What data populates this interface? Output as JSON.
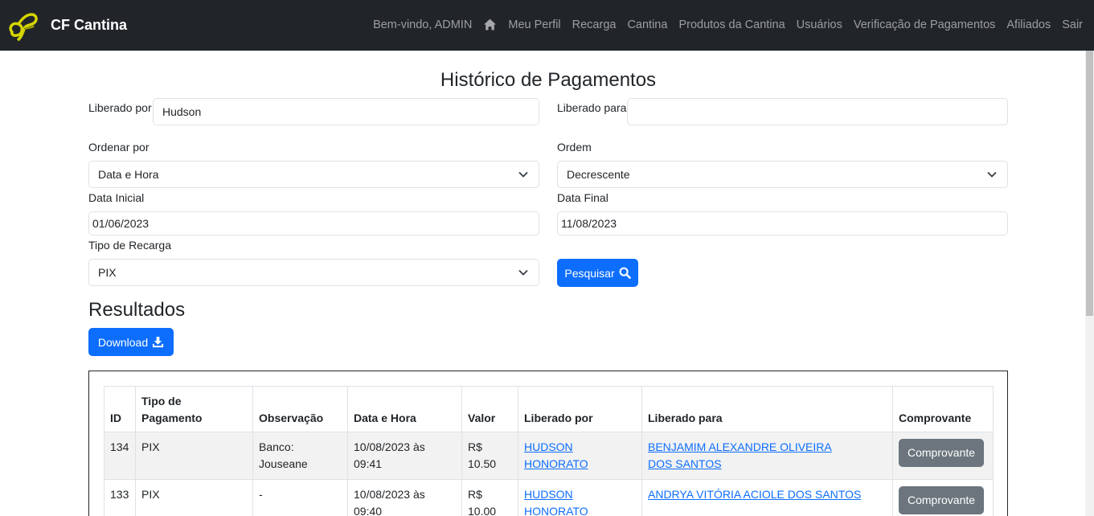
{
  "nav": {
    "brand": "CF Cantina",
    "welcome": "Bem-vindo, ADMIN",
    "links": [
      "Meu Perfil",
      "Recarga",
      "Cantina",
      "Produtos da Cantina",
      "Usuários",
      "Verificação de Pagamentos",
      "Afiliados",
      "Sair"
    ]
  },
  "page": {
    "title": "Histórico de Pagamentos"
  },
  "filters": {
    "liberado_por_label": "Liberado por",
    "liberado_por_value": "Hudson",
    "liberado_para_label": "Liberado para",
    "liberado_para_value": "",
    "ordenar_por_label": "Ordenar por",
    "ordenar_por_value": "Data e Hora",
    "ordem_label": "Ordem",
    "ordem_value": "Decrescente",
    "data_inicial_label": "Data Inicial",
    "data_inicial_value": "01/06/2023",
    "data_final_label": "Data Final",
    "data_final_value": "11/08/2023",
    "tipo_recarga_label": "Tipo de Recarga",
    "tipo_recarga_value": "PIX",
    "search_button": "Pesquisar"
  },
  "results": {
    "title": "Resultados",
    "download_button": "Download",
    "columns": [
      "ID",
      "Tipo de Pagamento",
      "Observação",
      "Data e Hora",
      "Valor",
      "Liberado por",
      "Liberado para",
      "Comprovante"
    ],
    "rows": [
      {
        "id": "134",
        "tipo": "PIX",
        "obs": "Banco: Jouseane",
        "data": "10/08/2023 às 09:41",
        "valor": "R$ 10.50",
        "por": "Hudson Honorato",
        "para": "Benjamim Alexandre Oliveira dos Santos",
        "comprovante": "Comprovante"
      },
      {
        "id": "133",
        "tipo": "PIX",
        "obs": "-",
        "data": "10/08/2023 às 09:40",
        "valor": "R$ 10.00",
        "por": "Hudson Honorato",
        "para": "Andrya Vitória Aciole dos Santos",
        "comprovante": "Comprovante"
      }
    ]
  },
  "colors": {
    "navbar": "#212529",
    "primary": "#0d6efd",
    "secondary": "#6c757d",
    "logo": "#d4d400"
  },
  "icons": {
    "home": "home-icon",
    "search": "search-icon",
    "download": "download-icon",
    "chevron": "chevron-down-icon"
  }
}
